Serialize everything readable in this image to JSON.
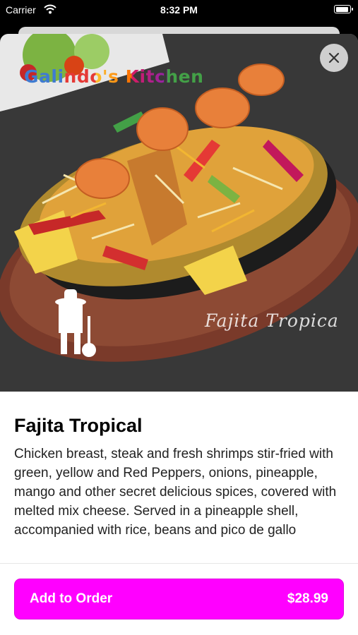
{
  "status_bar": {
    "carrier": "Carrier",
    "time": "8:32 PM"
  },
  "hero": {
    "logo_text": "Galindo's Kitchen",
    "watermark": "Fajita Tropica"
  },
  "item": {
    "title": "Fajita Tropical",
    "description": "Chicken breast, steak and fresh shrimps stir-fried with green, yellow and Red Peppers, onions, pineapple, mango and other secret delicious spices, covered with melted mix cheese. Served in a pineapple shell, accompanied with rice, beans and pico de gallo"
  },
  "order": {
    "button_label": "Add to Order",
    "price": "$28.99"
  },
  "colors": {
    "accent": "#ff00ff",
    "background": "#ffffff"
  }
}
